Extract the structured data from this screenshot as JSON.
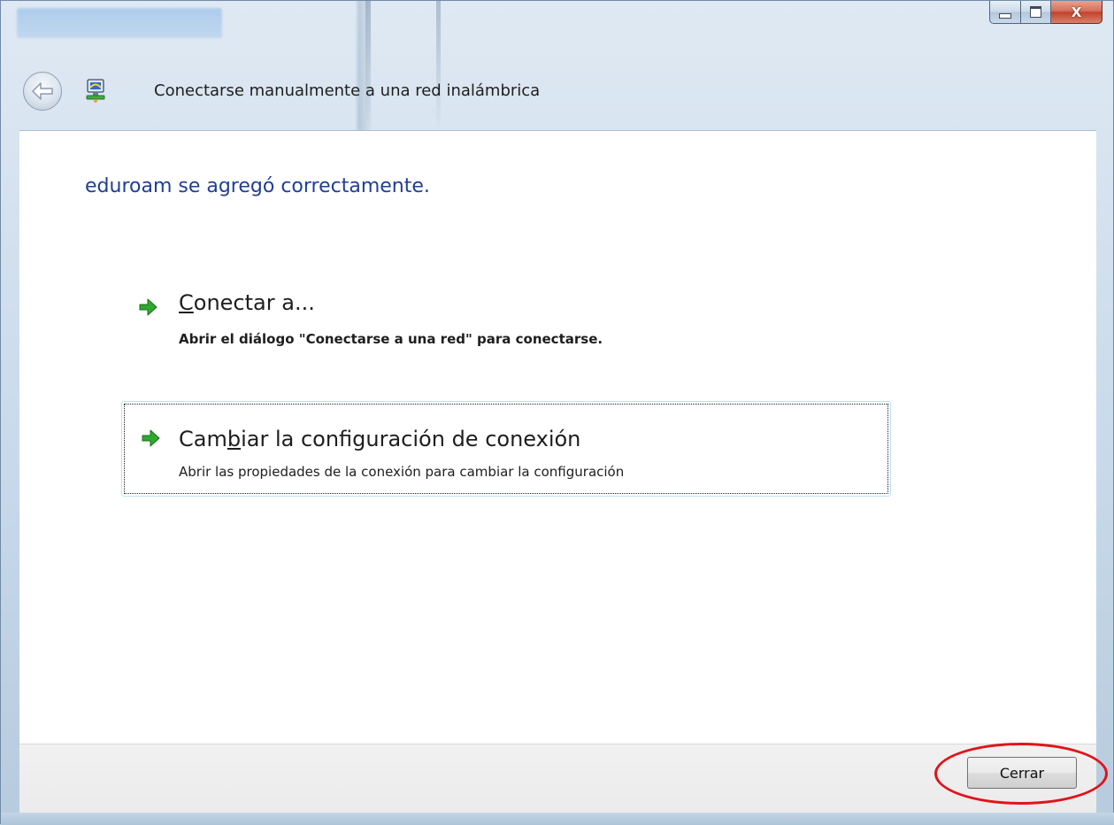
{
  "window": {
    "title": "Conectarse manualmente a una red inalámbrica",
    "caption_buttons": {
      "minimize": "minimize-icon",
      "maximize": "maximize-icon",
      "close": "X"
    },
    "back_icon": "back-arrow-icon",
    "app_icon": "network-icon"
  },
  "content": {
    "heading": "eduroam se agregó correctamente.",
    "commands": [
      {
        "title_pre": "",
        "title_accel": "C",
        "title_post": "onectar a...",
        "description": "Abrir el diálogo \"Conectarse a una red\" para conectarse.",
        "icon": "green-arrow-icon"
      },
      {
        "title_pre": "Cam",
        "title_accel": "b",
        "title_post": "iar la configuración de conexión",
        "description": "Abrir las propiedades de la conexión para cambiar la configuración",
        "icon": "green-arrow-icon"
      }
    ]
  },
  "footer": {
    "close_button_label": "Cerrar"
  },
  "colors": {
    "heading": "#1f3f93",
    "arrow": "#2a9a2a",
    "highlight": "#e0141a"
  }
}
